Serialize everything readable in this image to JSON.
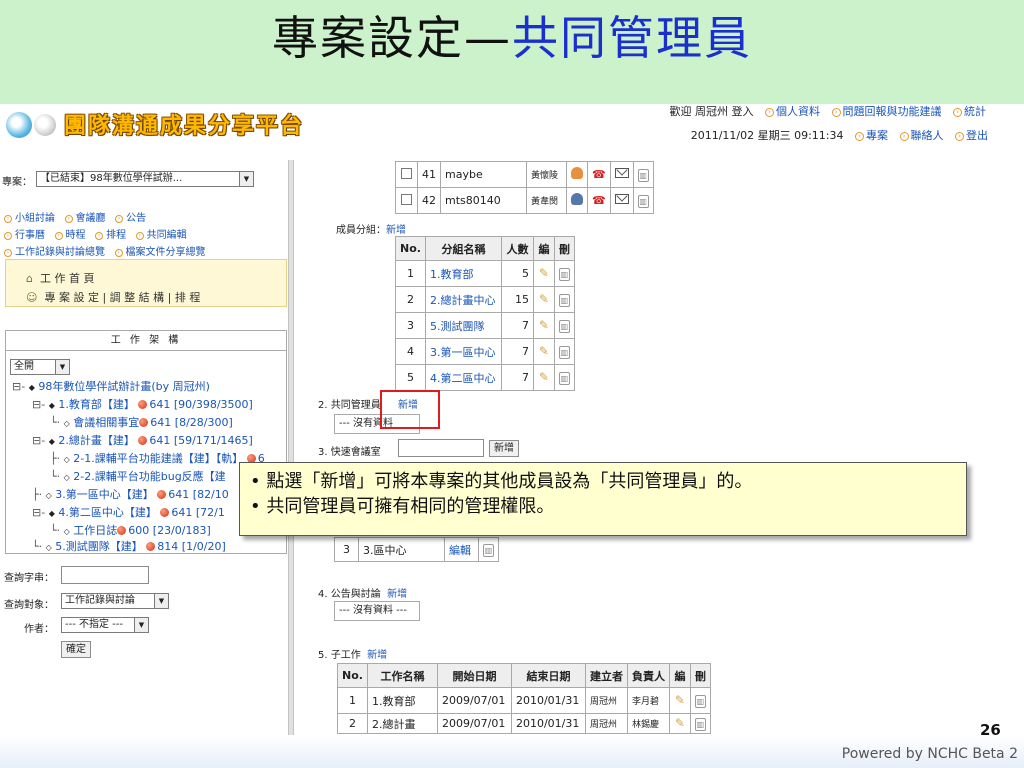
{
  "slide": {
    "title_part1": "專案設定—",
    "title_part2": "共同管理員",
    "page_number": "26",
    "powered_by": "Powered by NCHC Beta 2"
  },
  "header": {
    "logo_text": "團隊溝通成果分享平台",
    "welcome": "歡迎 周冠州 登入",
    "links_row1": [
      "個人資料",
      "問題回報與功能建議",
      "統計"
    ],
    "datetime": "2011/11/02 星期三 09:11:34",
    "links_row2": [
      "專案",
      "聯絡人",
      "登出"
    ]
  },
  "left": {
    "project_label": "專案：",
    "project_value": "【已結束】98年數位學伴試辦...",
    "links_line1": [
      "小組討論",
      "會議廳",
      "公告"
    ],
    "links_line2": [
      "行事曆",
      "時程",
      "排程",
      "共同編輯"
    ],
    "links_line3": [
      "工作記錄與討論總覽",
      "檔案文件分享總覽"
    ],
    "work_home": "工 作 首 頁",
    "work_settings": "專 案 設 定 | 調 整 結 構 | 排 程",
    "tree_title": "工 作 架 構",
    "tree_select": "全開",
    "tree_nodes": [
      {
        "text": "98年數位學伴試辦計畫(by 周冠州)",
        "stat": ""
      },
      {
        "text": "1.教育部【建】",
        "stat": "641 [90/398/3500]"
      },
      {
        "text": "會議相關事宜",
        "stat": "641 [8/28/300]"
      },
      {
        "text": "2.總計畫【建】",
        "stat": "641 [59/171/1465]"
      },
      {
        "text": "2-1.課輔平台功能建議【建】【軌】",
        "stat": "6"
      },
      {
        "text": "2-2.課輔平台功能bug反應【建",
        "stat": ""
      },
      {
        "text": "3.第一區中心【建】",
        "stat": "641 [82/10"
      },
      {
        "text": "4.第二區中心【建】",
        "stat": "641 [72/1"
      },
      {
        "text": "工作日誌",
        "stat": "600 [23/0/183]"
      },
      {
        "text": "5.測試團隊【建】",
        "stat": "814 [1/0/20]"
      }
    ],
    "search_label": "查詢字串：",
    "target_label": "查詢對象：",
    "target_value": "工作記錄與討論",
    "author_label": "作者：",
    "author_value": "--- 不指定 ---",
    "confirm": "確定"
  },
  "main": {
    "members": [
      {
        "no": "41",
        "name": "maybe",
        "owner": "黃懷陵"
      },
      {
        "no": "42",
        "name": "mts80140",
        "owner": "黃韋閔"
      }
    ],
    "group_label": "成員分組：",
    "group_add": "新增",
    "group_headers": [
      "No.",
      "分組名稱",
      "人數",
      "編",
      "刪"
    ],
    "groups": [
      {
        "no": "1",
        "name": "1.教育部",
        "count": "5"
      },
      {
        "no": "2",
        "name": "2.總計畫中心",
        "count": "15"
      },
      {
        "no": "3",
        "name": "5.測試團隊",
        "count": "7"
      },
      {
        "no": "4",
        "name": "3.第一區中心",
        "count": "7"
      },
      {
        "no": "5",
        "name": "4.第二區中心",
        "count": "7"
      }
    ],
    "co_admin_label": "2. 共同管理員",
    "co_admin_add": "新增",
    "no_data": "--- 沒有資料",
    "quick_label": "3. 快速會議室",
    "quick_add": "新增",
    "room_no": "3",
    "room_name": "3.區中心",
    "room_edit": "編輯",
    "announce_label": "4. 公告與討論",
    "announce_add": "新增",
    "announce_nodata": "--- 沒有資料 ---",
    "sub_label": "5. 子工作",
    "sub_add": "新增",
    "sub_headers": [
      "No.",
      "工作名稱",
      "開始日期",
      "結束日期",
      "建立者",
      "負責人",
      "編",
      "刪"
    ],
    "subs": [
      {
        "no": "1",
        "name": "1.教育部",
        "start": "2009/07/01",
        "end": "2010/01/31",
        "creator": "周冠州",
        "owner": "李月碧"
      },
      {
        "no": "2",
        "name": "2.總計畫",
        "start": "2009/07/01",
        "end": "2010/01/31",
        "creator": "周冠州",
        "owner": "林錫慶"
      }
    ]
  },
  "callout": {
    "line1": "點選「新增」可將本專案的其他成員設為「共同管理員」的。",
    "line2": "共同管理員可擁有相同的管理權限。"
  },
  "colors": {
    "header_green": "#ccf2cc",
    "title_blue": "#1b2fcc",
    "link_blue": "#1a55b8",
    "highlight_red": "#e21a1a",
    "callout_yellow": "#ffffcf"
  }
}
